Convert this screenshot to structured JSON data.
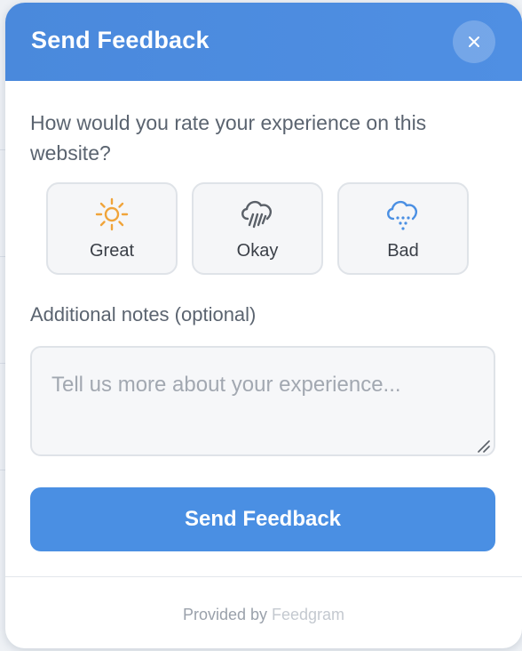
{
  "header": {
    "title": "Send Feedback",
    "close_icon": "close-icon"
  },
  "question": "How would you rate your experience on this website?",
  "ratings": [
    {
      "label": "Great",
      "icon": "sun-icon",
      "color": "#f0a43a"
    },
    {
      "label": "Okay",
      "icon": "rain-cloud-icon",
      "color": "#5a6068"
    },
    {
      "label": "Bad",
      "icon": "snow-cloud-icon",
      "color": "#4a8fe3"
    }
  ],
  "notes": {
    "label": "Additional notes (optional)",
    "value": "",
    "placeholder": "Tell us more about your experience..."
  },
  "submit_label": "Send Feedback",
  "footer": {
    "prefix": "Provided by",
    "brand": "Feedgram"
  },
  "colors": {
    "accent": "#4a8fe3",
    "header": "#4a89dc"
  }
}
